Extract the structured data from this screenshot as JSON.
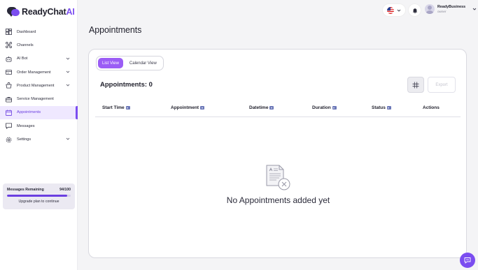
{
  "brand": {
    "name_main": "ReadyChat",
    "name_accent": "AI",
    "accent_color": "#7b4df0"
  },
  "sidebar": {
    "items": [
      {
        "label": "Dashboard",
        "icon": "dashboard-icon",
        "has_chevron": false,
        "active": false
      },
      {
        "label": "Channels",
        "icon": "channels-icon",
        "has_chevron": false,
        "active": false
      },
      {
        "label": "AI Bot",
        "icon": "bot-icon",
        "has_chevron": true,
        "active": false
      },
      {
        "label": "Order Management",
        "icon": "order-icon",
        "has_chevron": true,
        "active": false
      },
      {
        "label": "Product Management",
        "icon": "product-icon",
        "has_chevron": true,
        "active": false
      },
      {
        "label": "Service Management",
        "icon": "service-icon",
        "has_chevron": false,
        "active": false
      },
      {
        "label": "Appointments",
        "icon": "calendar-icon",
        "has_chevron": false,
        "active": true
      },
      {
        "label": "Messages",
        "icon": "messages-icon",
        "has_chevron": false,
        "active": false
      },
      {
        "label": "Settings",
        "icon": "gear-icon",
        "has_chevron": true,
        "active": false
      }
    ],
    "messages_card": {
      "label": "Messages Remaining",
      "count": "94/100",
      "used_fraction": 0.94,
      "upgrade_label": "Upgrade plan to continue"
    }
  },
  "header": {
    "language_icon": "us-flag-icon",
    "user_name": "ReadyBusiness",
    "user_role": "owner"
  },
  "page": {
    "title": "Appointments",
    "tabs": [
      {
        "label": "List View",
        "selected": true
      },
      {
        "label": "Calendar View",
        "selected": false
      }
    ],
    "count_label": "Appointments: 0",
    "export_label": "Export",
    "columns": [
      {
        "label": "Start Time",
        "sortable": true
      },
      {
        "label": "Appointment",
        "sortable": true
      },
      {
        "label": "Datetime",
        "sortable": true
      },
      {
        "label": "Duration",
        "sortable": true
      },
      {
        "label": "Status",
        "sortable": true
      },
      {
        "label": "Actions",
        "sortable": false
      }
    ],
    "empty_message": "No Appointments added yet"
  }
}
